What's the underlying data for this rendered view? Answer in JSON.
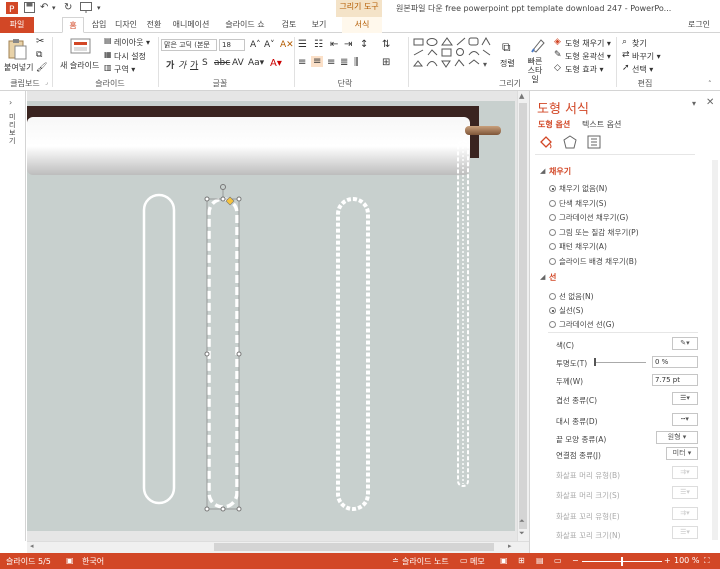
{
  "title": {
    "tools_group": "그리기 도구",
    "document": "원본파일 다운 free powerpoint ppt template download 247 - PowerPo..."
  },
  "tabs": [
    "파일",
    "홈",
    "삽입",
    "디자인",
    "전환",
    "애니메이션",
    "슬라이드 쇼",
    "검토",
    "보기",
    "서식"
  ],
  "signin": "로그인",
  "ribbon": {
    "clipboard": {
      "label": "클립보드",
      "paste": "붙여넣기"
    },
    "slides": {
      "label": "슬라이드",
      "new_slide": "새 슬라이드",
      "layout": "레이아웃 ▾",
      "reset": "다시 설정",
      "section": "구역 ▾"
    },
    "font": {
      "label": "글꼴",
      "font_name": "맑은 고딕 (본문",
      "font_size": "18"
    },
    "paragraph": {
      "label": "단락"
    },
    "drawing": {
      "label": "그리기",
      "arrange": "정렬",
      "quick_styles": "빠른 스타일",
      "fill": "도형 채우기 ▾",
      "outline": "도형 윤곽선 ▾",
      "effects": "도형 효과 ▾"
    },
    "editing": {
      "label": "편집",
      "find": "찾기",
      "replace": "바꾸기 ▾",
      "select": "선택 ▾"
    }
  },
  "thumbnails_label": "미리보기",
  "panel": {
    "title": "도형 서식",
    "tab_shape": "도형 옵션",
    "tab_text": "텍스트 옵션",
    "fill_section": "채우기",
    "fill_options": [
      "채우기 없음(N)",
      "단색 채우기(S)",
      "그라데이션 채우기(G)",
      "그림 또는 질감 채우기(P)",
      "패턴 채우기(A)",
      "슬라이드 배경 채우기(B)"
    ],
    "fill_selected": 0,
    "line_section": "선",
    "line_options": [
      "선 없음(N)",
      "실선(S)",
      "그라데이션 선(G)"
    ],
    "line_selected": 1,
    "props": {
      "color": "색(C)",
      "transparency": "투명도(T)",
      "transparency_value": "0 %",
      "transparency_level": 0,
      "width": "두께(W)",
      "width_value": "7.75 pt",
      "compound": "겹선 종류(C)",
      "dash": "대시 종류(D)",
      "cap": "끝 모양 종류(A)",
      "cap_value": "원형",
      "join": "연결점 종류(J)",
      "join_value": "미터",
      "arrow_begin_type": "화살표 머리 유형(B)",
      "arrow_begin_size": "화살표 머리 크기(S)",
      "arrow_end_type": "화살표 꼬리 유형(E)",
      "arrow_end_size": "화살표 꼬리 크기(N)"
    }
  },
  "status": {
    "slide": "슬라이드 5/5",
    "language": "한국어",
    "notes": "슬라이드 노트",
    "comments": "메모",
    "zoom": "100 %"
  },
  "colors": {
    "accent": "#d24726",
    "slide_bg": "#c8d0ce"
  }
}
